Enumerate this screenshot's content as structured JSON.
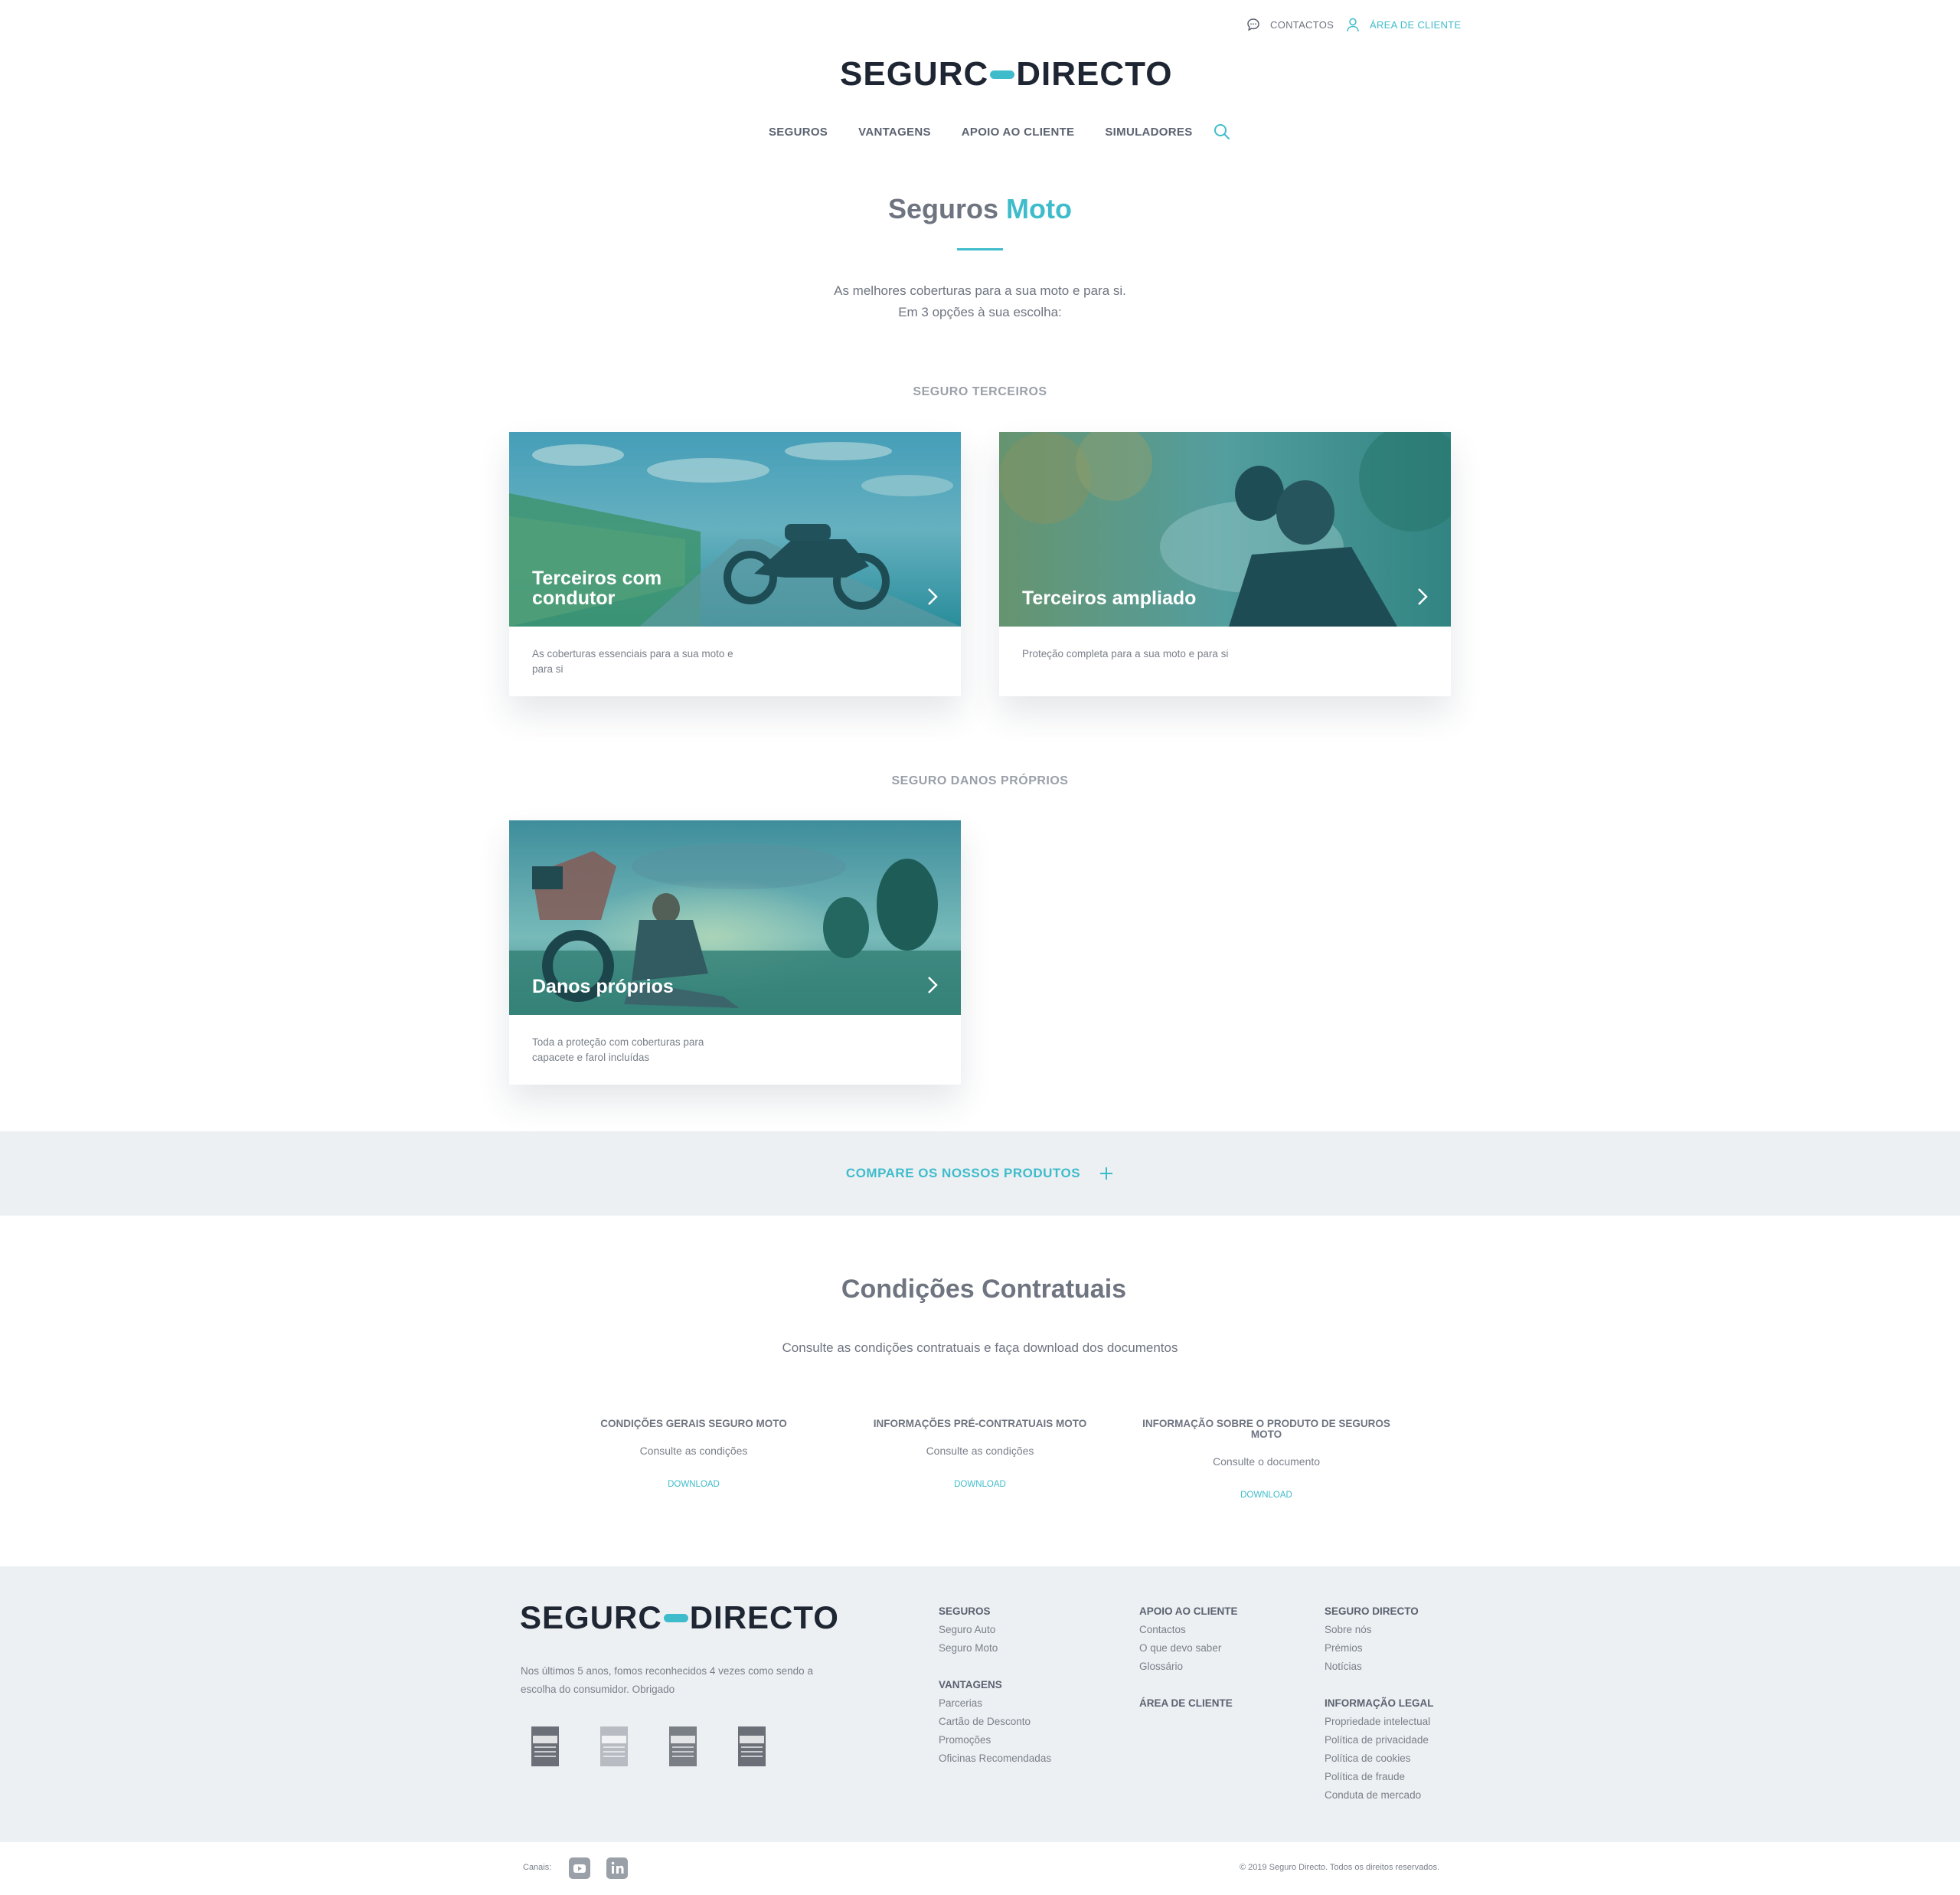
{
  "utility": {
    "contacts": "CONTACTOS",
    "client_area": "ÁREA DE CLIENTE"
  },
  "brand": {
    "logo_left": "SEGURC",
    "logo_right": "DIRECTO"
  },
  "nav": {
    "items": [
      "SEGUROS",
      "VANTAGENS",
      "APOIO AO CLIENTE",
      "SIMULADORES"
    ],
    "search_icon": "search-icon"
  },
  "hero": {
    "title_main": "Seguros",
    "title_accent": "Moto",
    "subtitle_line1": "As melhores coberturas para a sua moto e para si.",
    "subtitle_line2": "Em 3 opções à sua escolha:"
  },
  "sections": [
    {
      "label": "SEGURO TERCEIROS",
      "cards": [
        {
          "title": "Terceiros com condutor",
          "description": "As coberturas essenciais para a sua moto e para si"
        },
        {
          "title": "Terceiros ampliado",
          "description": "Proteção completa para a sua moto e para si"
        }
      ]
    },
    {
      "label": "SEGURO DANOS PRÓPRIOS",
      "cards": [
        {
          "title": "Danos próprios",
          "description": "Toda a proteção com coberturas para capacete e farol incluídas"
        }
      ]
    }
  ],
  "compare": {
    "label": "COMPARE OS NOSSOS PRODUTOS"
  },
  "conditions": {
    "title": "Condições Contratuais",
    "subtitle": "Consulte as condições contratuais e faça download dos documentos",
    "documents": [
      {
        "title": "CONDIÇÕES GERAIS SEGURO MOTO",
        "text": "Consulte as condições",
        "link": "DOWNLOAD"
      },
      {
        "title": "INFORMAÇÕES PRÉ-CONTRATUAIS MOTO",
        "text": "Consulte as condições",
        "link": "DOWNLOAD"
      },
      {
        "title": "INFORMAÇÃO SOBRE O PRODUTO DE SEGUROS MOTO",
        "text": "Consulte o documento",
        "link": "DOWNLOAD"
      }
    ]
  },
  "footer": {
    "tagline": "Nos últimos 5 anos, fomos reconhecidos 4 vezes como sendo a escolha do consumidor. Obrigado",
    "columns": {
      "seguros": {
        "title": "SEGUROS",
        "links": [
          "Seguro Auto",
          "Seguro Moto"
        ]
      },
      "vantagens": {
        "title": "VANTAGENS",
        "links": [
          "Parcerias",
          "Cartão de Desconto",
          "Promoções",
          "Oficinas Recomendadas"
        ]
      },
      "apoio": {
        "title": "APOIO AO CLIENTE",
        "links": [
          "Contactos",
          "O que devo saber",
          "Glossário"
        ]
      },
      "area_cliente": {
        "title": "ÁREA DE CLIENTE"
      },
      "seguro_directo": {
        "title": "SEGURO DIRECTO",
        "links": [
          "Sobre nós",
          "Prémios",
          "Notícias"
        ]
      },
      "legal": {
        "title": "INFORMAÇÃO LEGAL",
        "links": [
          "Propriedade intelectual",
          "Política de privacidade",
          "Política de cookies",
          "Política de fraude",
          "Conduta de mercado"
        ]
      }
    },
    "channels_label": "Canais:",
    "copyright": "© 2019 Seguro Directo. Todos os direitos reservados."
  },
  "colors": {
    "accent": "#3fbccb",
    "text": "#6e7480",
    "band": "#ecf0f3",
    "dark": "#1f2633"
  }
}
